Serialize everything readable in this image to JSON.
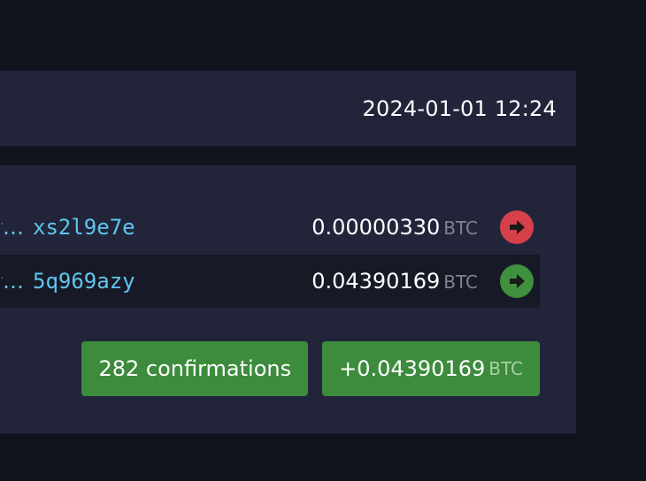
{
  "header": {
    "timestamp": "2024-01-01 12:24"
  },
  "transaction": {
    "rows": [
      {
        "address_lead": "f",
        "ellipsis": "…",
        "address_tail": "xs2l9e7e",
        "amount": "0.00000330",
        "unit": "BTC",
        "arrow_icon": "arrow-right-icon",
        "arrow_color": "#d64049"
      },
      {
        "address_lead": "f",
        "ellipsis": "…",
        "address_tail": "5q969azy",
        "amount": "0.04390169",
        "unit": "BTC",
        "arrow_icon": "arrow-right-icon",
        "arrow_color": "#3f913e"
      }
    ],
    "confirmations_label": "282 confirmations",
    "net_amount": "+0.04390169",
    "net_unit": "BTC"
  },
  "colors": {
    "background": "#11141c",
    "panel": "#22253a",
    "address": "#5fc6ef",
    "badge_green": "#3d8b3d"
  }
}
